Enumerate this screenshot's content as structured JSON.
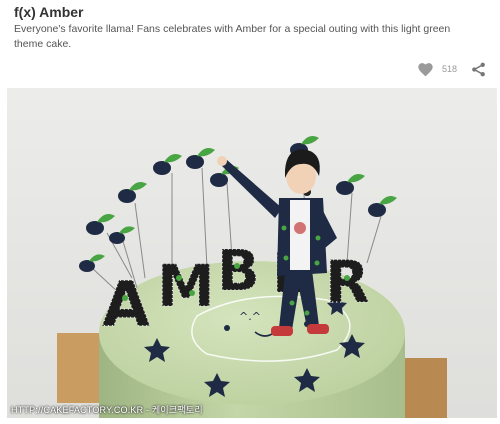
{
  "post": {
    "title": "f(x) Amber",
    "description": "Everyone's favorite llama! Fans celebrates with Amber for a special outing with this light green theme cake.",
    "like_count": "518"
  },
  "photo": {
    "watermark": "HTTP://CAKEFACTORY.CO.KR - 케이크팩토리",
    "cake_letters": [
      "A",
      "M",
      "B",
      "E",
      "R"
    ],
    "cake_face_text": "^.^"
  },
  "icons": {
    "like": "heart-icon",
    "share": "share-icon"
  },
  "colors": {
    "cake_green": "#c9dcb0",
    "leaf_green": "#49a544",
    "navy": "#1f2a44",
    "wall": "#e9e9e6"
  }
}
